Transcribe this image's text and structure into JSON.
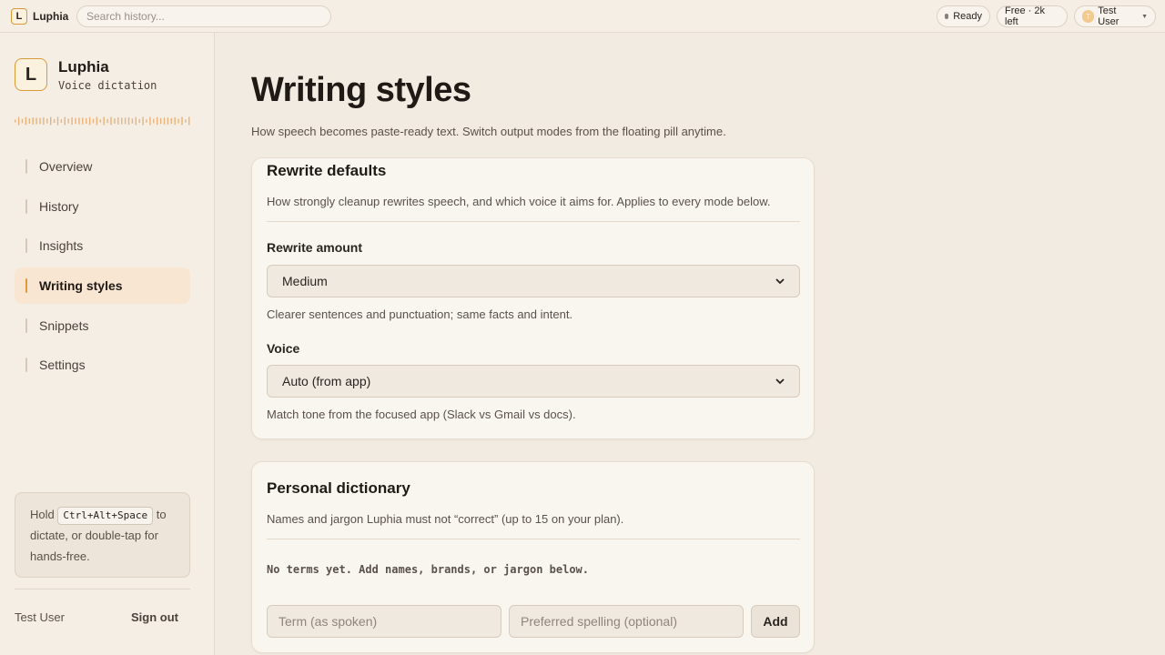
{
  "app": {
    "logo_letter": "L",
    "name": "Luphia",
    "subtitle": "Voice dictation"
  },
  "topbar": {
    "search_placeholder": "Search history...",
    "status": "Ready",
    "plan": "Free · 2k left",
    "user_initial": "T",
    "user_name": "Test User"
  },
  "sidebar": {
    "items": [
      {
        "label": "Overview",
        "active": false
      },
      {
        "label": "History",
        "active": false
      },
      {
        "label": "Insights",
        "active": false
      },
      {
        "label": "Writing styles",
        "active": true
      },
      {
        "label": "Snippets",
        "active": false
      },
      {
        "label": "Settings",
        "active": false
      }
    ],
    "tip": {
      "prefix": "Hold",
      "shortcut": "Ctrl+Alt+Space",
      "suffix": "to dictate, or double-tap for hands-free."
    },
    "user": "Test User",
    "sign_out": "Sign out"
  },
  "page": {
    "title": "Writing styles",
    "subtitle": "How speech becomes paste-ready text. Switch output modes from the floating pill anytime."
  },
  "rewrite_card": {
    "title": "Rewrite defaults",
    "description": "How strongly cleanup rewrites speech, and which voice it aims for. Applies to every mode below.",
    "amount_label": "Rewrite amount",
    "amount_value": "Medium",
    "amount_help": "Clearer sentences and punctuation; same facts and intent.",
    "voice_label": "Voice",
    "voice_value": "Auto (from app)",
    "voice_help": "Match tone from the focused app (Slack vs Gmail vs docs)."
  },
  "dictionary_card": {
    "title": "Personal dictionary",
    "description": "Names and jargon Luphia must not “correct” (up to 15 on your plan).",
    "empty": "No terms yet. Add names, brands, or jargon below.",
    "term_placeholder": "Term (as spoken)",
    "spelling_placeholder": "Preferred spelling (optional)",
    "add_label": "Add"
  },
  "colors": {
    "background": "#f2ebe1",
    "accent": "#e39a3c",
    "card": "#f9f6f0",
    "active_nav": "#f9e6d2"
  }
}
